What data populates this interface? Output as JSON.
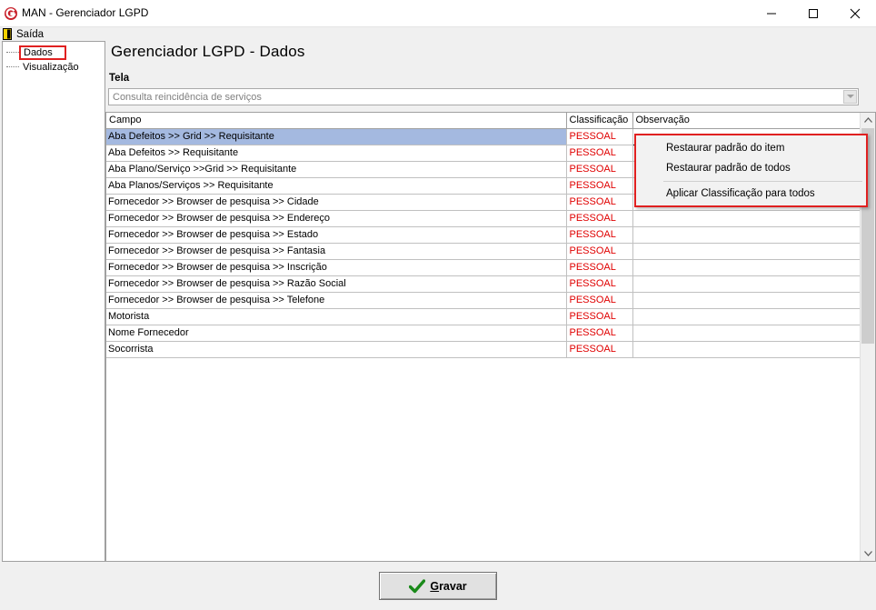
{
  "window": {
    "title": "MAN - Gerenciador LGPD",
    "icons": [
      "app-logo-icon",
      "minimize-icon",
      "maximize-icon",
      "close-icon"
    ]
  },
  "menubar": {
    "exit_label": "Saída"
  },
  "tree": {
    "items": [
      {
        "label": "Dados",
        "selected": true
      },
      {
        "label": "Visualização",
        "selected": false
      }
    ]
  },
  "main": {
    "page_title": "Gerenciador LGPD - Dados",
    "tela_label": "Tela",
    "tela_value": "Consulta reincidência de serviços"
  },
  "grid": {
    "columns": [
      "Campo",
      "Classificação",
      "Observação"
    ],
    "rows": [
      {
        "campo": "Aba Defeitos >> Grid >> Requisitante",
        "classificacao": "PESSOAL",
        "observacao": ""
      },
      {
        "campo": "Aba Defeitos >> Requisitante",
        "classificacao": "PESSOAL",
        "observacao": ""
      },
      {
        "campo": "Aba Plano/Serviço >>Grid >> Requisitante",
        "classificacao": "PESSOAL",
        "observacao": ""
      },
      {
        "campo": "Aba Planos/Serviços >> Requisitante",
        "classificacao": "PESSOAL",
        "observacao": ""
      },
      {
        "campo": "Fornecedor >> Browser de pesquisa >> Cidade",
        "classificacao": "PESSOAL",
        "observacao": ""
      },
      {
        "campo": "Fornecedor >> Browser de pesquisa >> Endereço",
        "classificacao": "PESSOAL",
        "observacao": ""
      },
      {
        "campo": "Fornecedor >> Browser de pesquisa >> Estado",
        "classificacao": "PESSOAL",
        "observacao": ""
      },
      {
        "campo": "Fornecedor >> Browser de pesquisa >> Fantasia",
        "classificacao": "PESSOAL",
        "observacao": ""
      },
      {
        "campo": "Fornecedor >> Browser de pesquisa >> Inscrição",
        "classificacao": "PESSOAL",
        "observacao": ""
      },
      {
        "campo": "Fornecedor >> Browser de pesquisa >> Razão Social",
        "classificacao": "PESSOAL",
        "observacao": ""
      },
      {
        "campo": "Fornecedor >> Browser de pesquisa >> Telefone",
        "classificacao": "PESSOAL",
        "observacao": ""
      },
      {
        "campo": "Motorista",
        "classificacao": "PESSOAL",
        "observacao": ""
      },
      {
        "campo": "Nome Fornecedor",
        "classificacao": "PESSOAL",
        "observacao": ""
      },
      {
        "campo": "Socorrista",
        "classificacao": "PESSOAL",
        "observacao": ""
      }
    ],
    "selected_row": 0
  },
  "context_menu": {
    "items": [
      "Restaurar padrão do item",
      "Restaurar padrão de todos",
      "Aplicar Classificação para todos"
    ]
  },
  "footer": {
    "save_accel": "G",
    "save_rest": "ravar"
  },
  "colors": {
    "classification_text": "#e00000",
    "selection_bg": "#a4b9e0",
    "highlight_border": "#e02020",
    "save_check": "#1a8a1a"
  }
}
